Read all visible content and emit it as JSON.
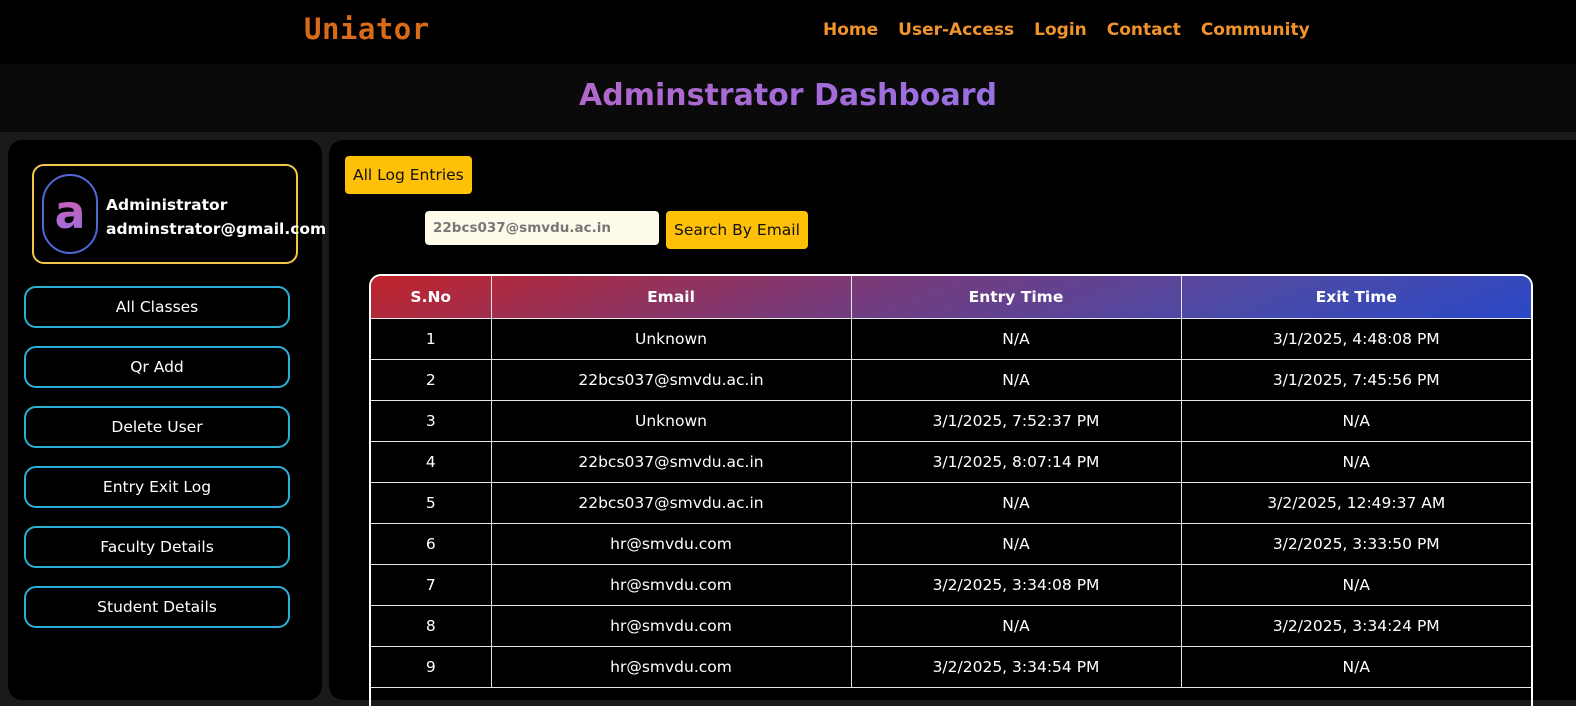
{
  "nav": {
    "brand": "Uniator",
    "links": [
      "Home",
      "User-Access",
      "Login",
      "Contact",
      "Community"
    ]
  },
  "header": {
    "title": "Adminstrator Dashboard"
  },
  "sidebar": {
    "profile": {
      "avatar_letter": "a",
      "name": "Administrator",
      "email": "adminstrator@gmail.com"
    },
    "buttons": [
      "All Classes",
      "Qr Add",
      "Delete User",
      "Entry Exit Log",
      "Faculty Details",
      "Student Details"
    ]
  },
  "main": {
    "all_log_label": "All Log Entries",
    "search": {
      "value": "22bcs037@smvdu.ac.in",
      "button_label": "Search By Email"
    },
    "table": {
      "headers": [
        "S.No",
        "Email",
        "Entry Time",
        "Exit Time"
      ],
      "rows": [
        [
          "1",
          "Unknown",
          "N/A",
          "3/1/2025, 4:48:08 PM"
        ],
        [
          "2",
          "22bcs037@smvdu.ac.in",
          "N/A",
          "3/1/2025, 7:45:56 PM"
        ],
        [
          "3",
          "Unknown",
          "3/1/2025, 7:52:37 PM",
          "N/A"
        ],
        [
          "4",
          "22bcs037@smvdu.ac.in",
          "3/1/2025, 8:07:14 PM",
          "N/A"
        ],
        [
          "5",
          "22bcs037@smvdu.ac.in",
          "N/A",
          "3/2/2025, 12:49:37 AM"
        ],
        [
          "6",
          "hr@smvdu.com",
          "N/A",
          "3/2/2025, 3:33:50 PM"
        ],
        [
          "7",
          "hr@smvdu.com",
          "3/2/2025, 3:34:08 PM",
          "N/A"
        ],
        [
          "8",
          "hr@smvdu.com",
          "N/A",
          "3/2/2025, 3:34:24 PM"
        ],
        [
          "9",
          "hr@smvdu.com",
          "3/2/2025, 3:34:54 PM",
          "N/A"
        ]
      ]
    }
  }
}
